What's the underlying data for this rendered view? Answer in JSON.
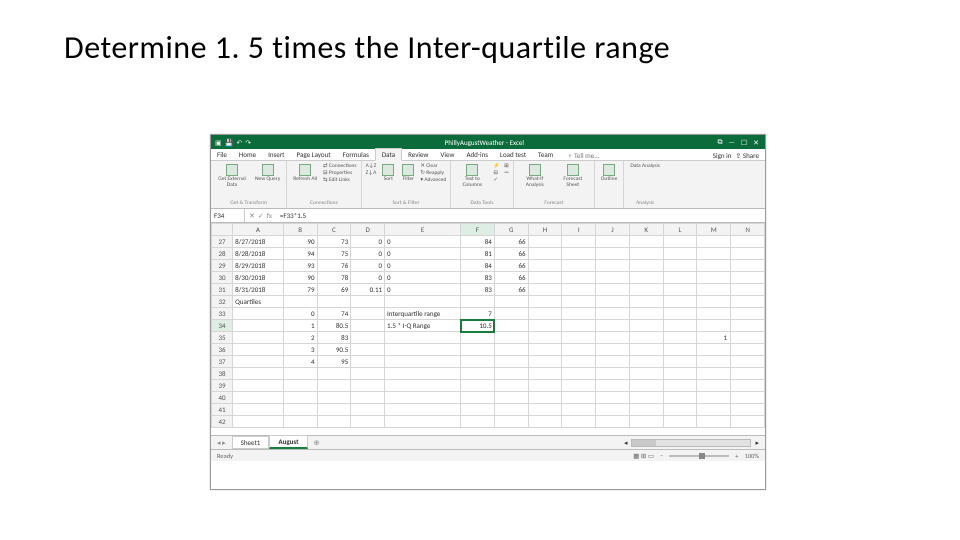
{
  "slide": {
    "title": "Determine 1. 5 times the Inter-quartile range"
  },
  "titlebar": {
    "doc": "PhillyAugustWeather - Excel",
    "qat": {
      "save": "💾",
      "undo": "↶",
      "redo": "↷"
    },
    "win": {
      "opts": "⧉",
      "min": "—",
      "max": "☐",
      "close": "✕"
    }
  },
  "tabs": {
    "items": [
      "File",
      "Home",
      "Insert",
      "Page Layout",
      "Formulas",
      "Data",
      "Review",
      "View",
      "Add-ins",
      "Load test",
      "Team"
    ],
    "active": "Data",
    "tell": "♀ Tell me...",
    "signin": "Sign in",
    "share": "⇪ Share"
  },
  "ribbon": {
    "g1": {
      "b1": "Get External Data",
      "label": "Get & Transform"
    },
    "g1b2": "New Query",
    "g2": {
      "b1": "Refresh All",
      "s1": "⇄ Connections",
      "s2": "⊟ Properties",
      "s3": "⇆ Edit Links",
      "label": "Connections"
    },
    "g3": {
      "sortAZ": "A↓Z",
      "sortZA": "Z↓A",
      "sort": "Sort",
      "filter": "Filter",
      "s1": "✕ Clear",
      "s2": "↻ Reapply",
      "s3": "▾ Advanced",
      "label": "Sort & Filter"
    },
    "g4": {
      "b1": "Text to Columns",
      "label": "Data Tools"
    },
    "g5": {
      "b1": "What-If Analysis",
      "b2": "Forecast Sheet",
      "label": "Forecast"
    },
    "g6": {
      "b1": "Outline",
      "label": ""
    },
    "g7": {
      "b1": "Data Analysis",
      "label": "Analysis"
    }
  },
  "formula": {
    "name": "F34",
    "fx": "fx",
    "value": "=F33*1.5"
  },
  "cols": [
    "A",
    "B",
    "C",
    "D",
    "E",
    "F",
    "G",
    "H",
    "I",
    "J",
    "K",
    "L",
    "M",
    "N"
  ],
  "rows": [
    {
      "n": "27",
      "c": [
        "8/27/2018",
        "90",
        "73",
        "0",
        "0",
        "84",
        "66",
        "",
        "",
        "",
        "",
        "",
        "",
        ""
      ]
    },
    {
      "n": "28",
      "c": [
        "8/28/2018",
        "94",
        "75",
        "0",
        "0",
        "81",
        "66",
        "",
        "",
        "",
        "",
        "",
        "",
        ""
      ]
    },
    {
      "n": "29",
      "c": [
        "8/29/2018",
        "93",
        "76",
        "0",
        "0",
        "84",
        "66",
        "",
        "",
        "",
        "",
        "",
        "",
        ""
      ]
    },
    {
      "n": "30",
      "c": [
        "8/30/2018",
        "90",
        "78",
        "0",
        "0",
        "83",
        "66",
        "",
        "",
        "",
        "",
        "",
        "",
        ""
      ]
    },
    {
      "n": "31",
      "c": [
        "8/31/2018",
        "79",
        "69",
        "0.11",
        "0",
        "83",
        "66",
        "",
        "",
        "",
        "",
        "",
        "",
        ""
      ]
    },
    {
      "n": "32",
      "c": [
        "Quartiles",
        "",
        "",
        "",
        "",
        "",
        "",
        "",
        "",
        "",
        "",
        "",
        "",
        ""
      ]
    },
    {
      "n": "33",
      "c": [
        "",
        "0",
        "74",
        "",
        "Interquartile range",
        "7",
        "",
        "",
        "",
        "",
        "",
        "",
        "",
        ""
      ]
    },
    {
      "n": "34",
      "c": [
        "",
        "1",
        "80.5",
        "",
        "1.5 * I-Q Range",
        "10.5",
        "",
        "",
        "",
        "",
        "",
        "",
        "",
        ""
      ]
    },
    {
      "n": "35",
      "c": [
        "",
        "2",
        "83",
        "",
        "",
        "",
        "",
        "",
        "",
        "",
        "",
        "",
        "",
        ""
      ]
    },
    {
      "n": "36",
      "c": [
        "",
        "3",
        "90.5",
        "",
        "",
        "",
        "",
        "",
        "",
        "",
        "",
        "",
        "",
        ""
      ]
    },
    {
      "n": "37",
      "c": [
        "",
        "4",
        "95",
        "",
        "",
        "",
        "",
        "",
        "",
        "",
        "",
        "",
        "",
        ""
      ]
    },
    {
      "n": "38",
      "c": [
        "",
        "",
        "",
        "",
        "",
        "",
        "",
        "",
        "",
        "",
        "",
        "",
        "",
        ""
      ]
    },
    {
      "n": "39",
      "c": [
        "",
        "",
        "",
        "",
        "",
        "",
        "",
        "",
        "",
        "",
        "",
        "",
        "",
        ""
      ]
    },
    {
      "n": "40",
      "c": [
        "",
        "",
        "",
        "",
        "",
        "",
        "",
        "",
        "",
        "",
        "",
        "",
        "",
        ""
      ]
    },
    {
      "n": "41",
      "c": [
        "",
        "",
        "",
        "",
        "",
        "",
        "",
        "",
        "",
        "",
        "",
        "",
        "",
        ""
      ]
    },
    {
      "n": "42",
      "c": [
        "",
        "",
        "",
        "",
        "",
        "",
        "",
        "",
        "",
        "",
        "",
        "",
        "",
        ""
      ]
    }
  ],
  "numAlign": {
    "B": 1,
    "C": 1,
    "D": 1,
    "E": 0,
    "F": 1,
    "G": 1
  },
  "sel": {
    "row": "34",
    "col": "F"
  },
  "floating": "1",
  "sheets": {
    "s1": "Sheet1",
    "s2": "August",
    "plus": "⊕",
    "nav": "◂ ▸"
  },
  "status": {
    "ready": "Ready",
    "views": "▦  ⊞  ▭",
    "zoom": "100%",
    "minus": "−",
    "plus": "+"
  }
}
